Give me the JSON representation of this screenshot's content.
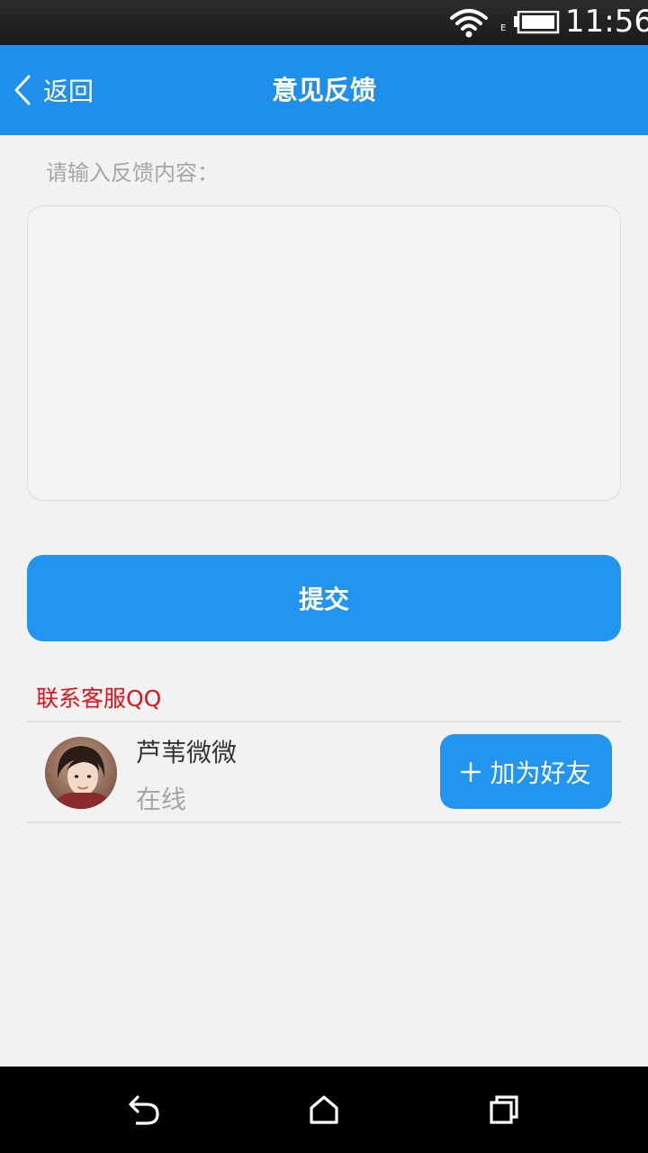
{
  "status_bar": {
    "network_type": "E",
    "time": "11:56",
    "icons": [
      "wifi-icon",
      "battery-icon"
    ]
  },
  "app_bar": {
    "back_label": "返回",
    "title": "意见反馈",
    "background_color": "#1e8fea"
  },
  "feedback": {
    "label": "请输入反馈内容：",
    "input_value": "",
    "placeholder": ""
  },
  "submit": {
    "label": "提交",
    "color": "#2195f0"
  },
  "contact_section": {
    "title": "联系客服QQ",
    "title_color": "#e0141a",
    "contacts": [
      {
        "name": "芦苇微微",
        "status": "在线",
        "action_label": "加为好友",
        "action_icon": "plus-icon"
      }
    ]
  },
  "nav_bar": {
    "buttons": [
      "back-nav-icon",
      "home-nav-icon",
      "recents-nav-icon"
    ]
  }
}
